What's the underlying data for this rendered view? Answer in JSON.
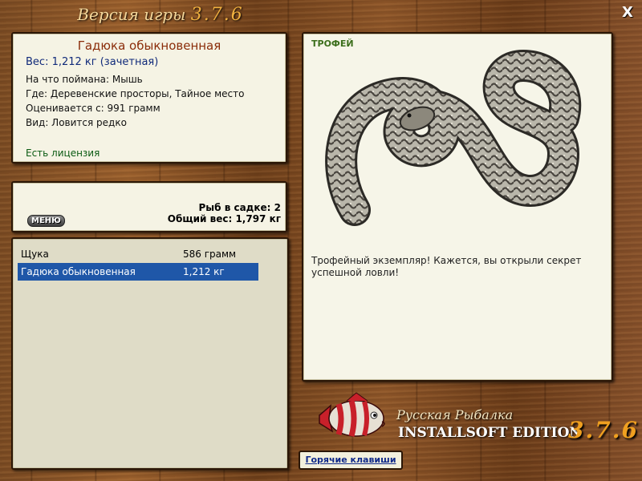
{
  "header": {
    "title_prefix": "Версия игры",
    "version": "3.7.6",
    "close_label": "X"
  },
  "fish_info": {
    "name": "Гадюка обыкновенная",
    "weight_line": "Вес: 1,212 кг (зачетная)",
    "lines": [
      "На что поймана: Мышь",
      "Где: Деревенские просторы, Тайное место",
      "Оценивается с: 991 грамм",
      "Вид: Ловится редко"
    ],
    "license": "Есть лицензия"
  },
  "keep_net": {
    "menu_label": "МЕНЮ",
    "count_line": "Рыб в садке: 2",
    "total_line": "Общий вес: 1,797 кг"
  },
  "fish_list": [
    {
      "name": "Щука",
      "weight": "586 грамм",
      "selected": false
    },
    {
      "name": "Гадюка обыкновенная",
      "weight": "1,212 кг",
      "selected": true
    }
  ],
  "trophy": {
    "badge": "ТРОФЕЙ",
    "image_icon": "snake-trophy-image",
    "text": "Трофейный экземпляр! Кажется, вы открыли секрет успешной ловли!"
  },
  "logo": {
    "line1": "Русская Рыбалка",
    "line2": "INSTALLSOFT EDITION",
    "version": "3.7.6",
    "icon": "fish-logo-icon"
  },
  "footer": {
    "hotkeys_label": "Горячие клавиши"
  },
  "colors": {
    "selection": "#1f57a8",
    "accent_version": "#f0a020",
    "fish_name": "#8b2d0a",
    "license": "#0a5a12"
  }
}
